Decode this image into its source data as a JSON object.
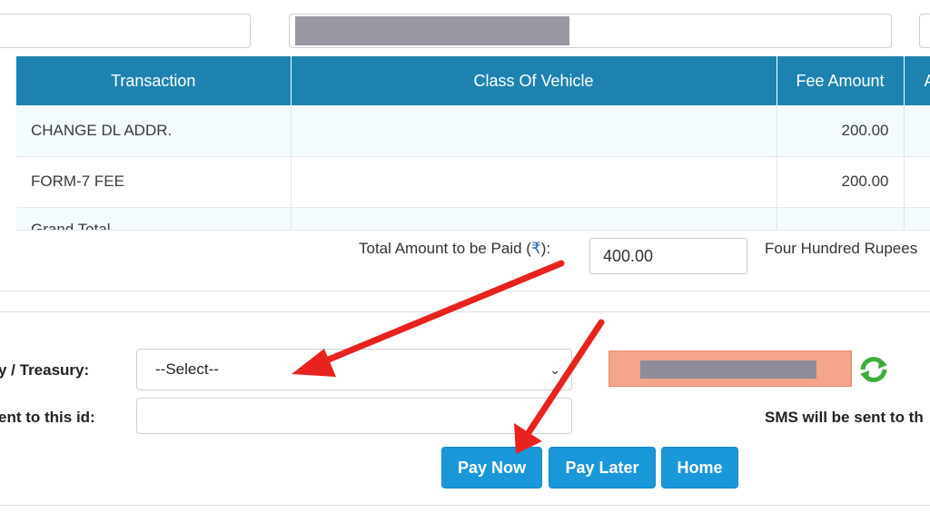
{
  "table": {
    "headers": [
      "Transaction",
      "Class Of Vehicle",
      "Fee Amount",
      "A"
    ],
    "rows": [
      {
        "transaction": "CHANGE DL ADDR.",
        "class_of_vehicle": "",
        "fee_amount": "200.00"
      },
      {
        "transaction": "FORM-7 FEE",
        "class_of_vehicle": "",
        "fee_amount": "200.00"
      }
    ],
    "partial_row_label": "Grand Total"
  },
  "total": {
    "label": "Total Amount to be Paid (",
    "rupee_symbol": "₹",
    "label_suffix": "):",
    "value": "400.00",
    "words": "Four Hundred Rupees"
  },
  "payment": {
    "treasury_label": "y / Treasury:",
    "treasury_selected": "--Select--",
    "id_label": "ent to this id:",
    "sms_note": "SMS will be sent to th"
  },
  "buttons": {
    "pay_now": "Pay Now",
    "pay_later": "Pay Later",
    "home": "Home"
  },
  "colors": {
    "header_blue": "#1e82b0",
    "button_blue": "#1a97d9",
    "arrow_red": "#e8231f",
    "captcha_bg": "#f4a58c"
  }
}
